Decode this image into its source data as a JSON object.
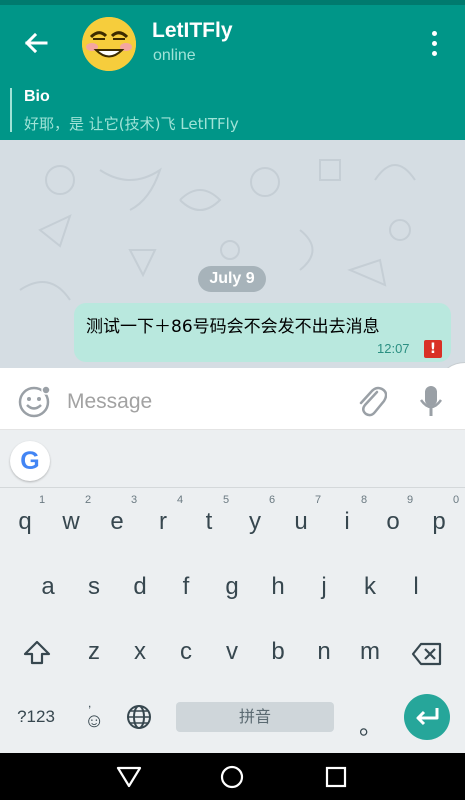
{
  "header": {
    "title": "LetITFly",
    "status": "online"
  },
  "bio": {
    "label": "Bio",
    "text": "好耶，是 让它(技术)飞 LetITFly"
  },
  "chat": {
    "date": "July 9",
    "message": {
      "text": "测试一下＋86号码会不会发不出去消息",
      "time": "12:07",
      "error_mark": "!"
    }
  },
  "composer": {
    "placeholder": "Message"
  },
  "keyboard": {
    "rows": [
      [
        {
          "k": "q",
          "hint": "1"
        },
        {
          "k": "w",
          "hint": "2"
        },
        {
          "k": "e",
          "hint": "3"
        },
        {
          "k": "r",
          "hint": "4"
        },
        {
          "k": "t",
          "hint": "5"
        },
        {
          "k": "y",
          "hint": "6"
        },
        {
          "k": "u",
          "hint": "7"
        },
        {
          "k": "i",
          "hint": "8"
        },
        {
          "k": "o",
          "hint": "9"
        },
        {
          "k": "p",
          "hint": "0"
        }
      ],
      [
        {
          "k": "a"
        },
        {
          "k": "s"
        },
        {
          "k": "d"
        },
        {
          "k": "f"
        },
        {
          "k": "g"
        },
        {
          "k": "h"
        },
        {
          "k": "j"
        },
        {
          "k": "k"
        },
        {
          "k": "l"
        }
      ],
      [
        {
          "k": "z"
        },
        {
          "k": "x"
        },
        {
          "k": "c"
        },
        {
          "k": "v"
        },
        {
          "k": "b"
        },
        {
          "k": "n"
        },
        {
          "k": "m"
        }
      ]
    ],
    "symbols_label": "?123",
    "emoji_label": "☺",
    "emoji_hint": ",",
    "space_label": "拼音",
    "period_label": "。",
    "google_label": "G"
  },
  "icons": [
    "back-arrow-icon",
    "menu-dots-icon",
    "emoji-icon",
    "attach-icon",
    "mic-icon",
    "shift-icon",
    "backspace-icon",
    "globe-icon",
    "enter-icon",
    "nav-back-icon",
    "nav-home-icon",
    "nav-recents-icon",
    "chevron-left-icon"
  ],
  "colors": {
    "primary": "#009688",
    "primary_dark": "#007a6e",
    "bubble": "#b9e8de",
    "error": "#d93025"
  }
}
